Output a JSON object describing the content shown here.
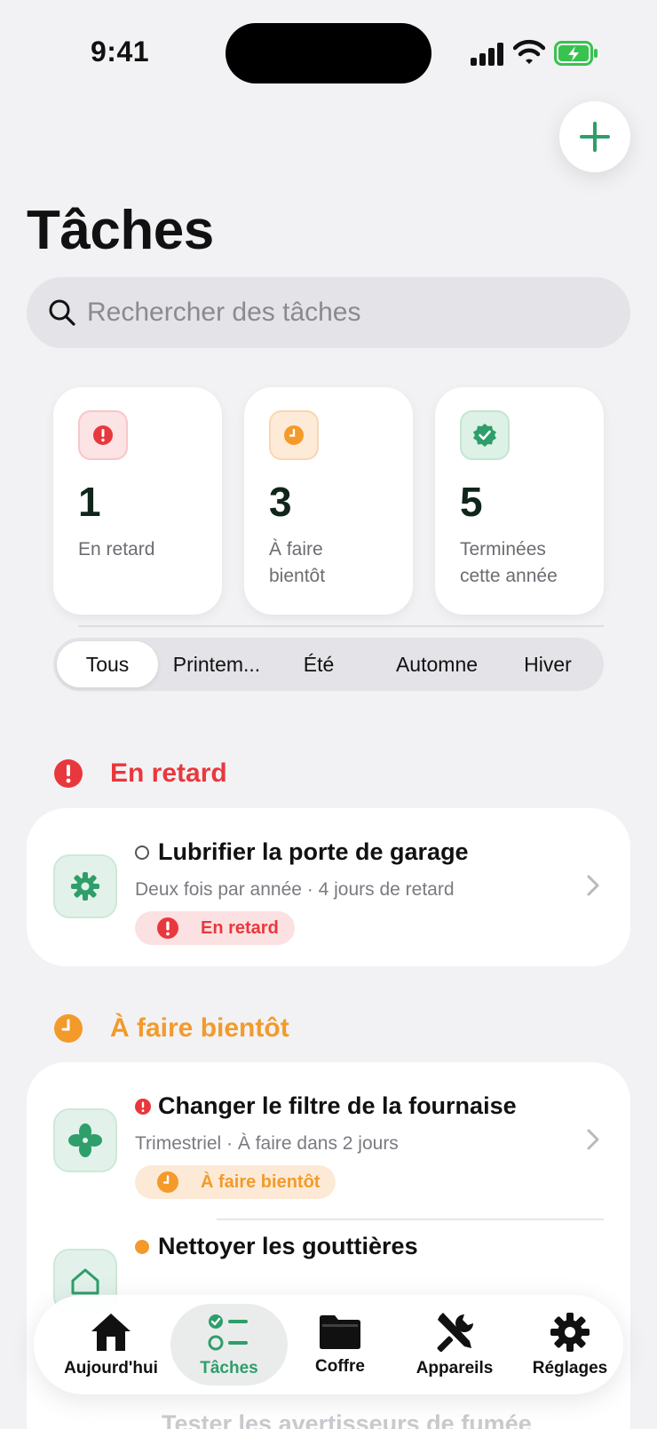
{
  "status_bar": {
    "time": "9:41"
  },
  "header": {
    "title": "Tâches",
    "add_icon": "plus-icon"
  },
  "search": {
    "placeholder": "Rechercher des tâches",
    "icon": "search-icon"
  },
  "stats": [
    {
      "value": "1",
      "label": "En retard",
      "icon": "alert-icon",
      "color": "#E8383D"
    },
    {
      "value": "3",
      "label": "À faire bientôt",
      "icon": "clock-icon",
      "color": "#F39A2B"
    },
    {
      "value": "5",
      "label": "Terminées cette année",
      "icon": "check-badge-icon",
      "color": "#2E9E6A"
    }
  ],
  "filters": {
    "items": [
      "Tous",
      "Printem...",
      "Été",
      "Automne",
      "Hiver"
    ],
    "selected": "Tous"
  },
  "sections": {
    "overdue": {
      "title": "En retard",
      "color": "#E8383D",
      "tasks": [
        {
          "title": "Lubrifier la porte de garage",
          "subtitle": "Deux fois par année · 4 jours de retard",
          "badge": "En retard",
          "icon": "gear-icon"
        }
      ]
    },
    "soon": {
      "title": "À faire bientôt",
      "color": "#F39A2B",
      "tasks": [
        {
          "title": "Changer le filtre de la fournaise",
          "subtitle": "Trimestriel · À faire dans 2 jours",
          "badge": "À faire bientôt",
          "icon": "fan-icon"
        },
        {
          "title": "Nettoyer les gouttières",
          "icon": "house-icon"
        },
        {
          "title": "Tester les avertisseurs de fumée"
        }
      ]
    }
  },
  "tabbar": {
    "items": [
      {
        "label": "Aujourd'hui",
        "icon": "house-icon"
      },
      {
        "label": "Tâches",
        "icon": "checklist-icon"
      },
      {
        "label": "Coffre",
        "icon": "folder-icon"
      },
      {
        "label": "Appareils",
        "icon": "tools-icon"
      },
      {
        "label": "Réglages",
        "icon": "gear-icon"
      }
    ],
    "selected": "Tâches"
  },
  "colors": {
    "accent": "#2E9E6A",
    "danger": "#E8383D",
    "warning": "#F39A2B"
  }
}
